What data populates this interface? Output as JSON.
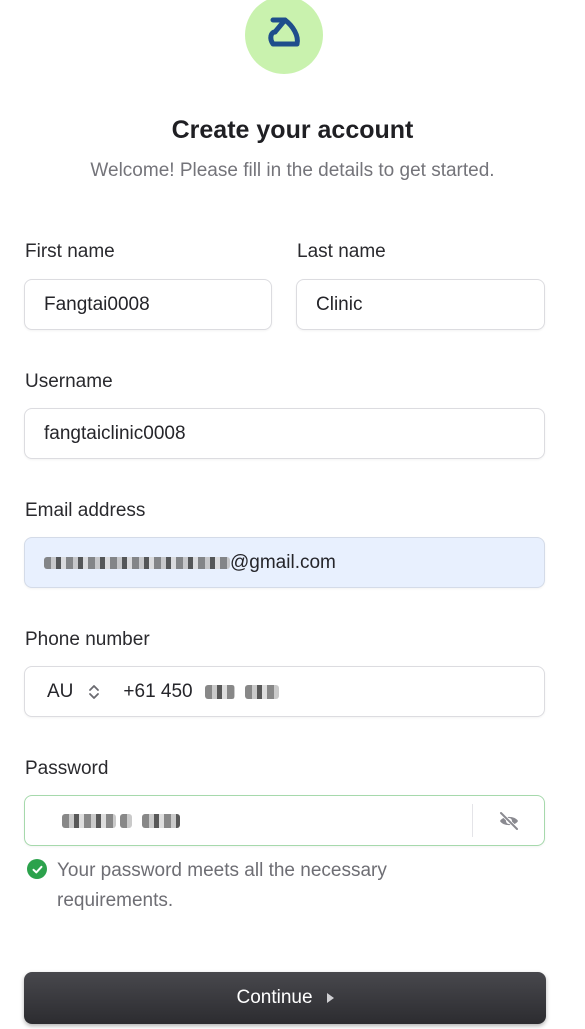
{
  "header": {
    "title": "Create your account",
    "subtitle": "Welcome! Please fill in the details to get started."
  },
  "form": {
    "first_name": {
      "label": "First name",
      "value": "Fangtai0008"
    },
    "last_name": {
      "label": "Last name",
      "value": "Clinic"
    },
    "username": {
      "label": "Username",
      "value": "fangtaiclinic0008"
    },
    "email": {
      "label": "Email address",
      "value_suffix": "@gmail.com"
    },
    "phone": {
      "label": "Phone number",
      "country": "AU",
      "prefix": "+61 450"
    },
    "password": {
      "label": "Password"
    },
    "password_validation": "Your password meets all the necessary requirements."
  },
  "actions": {
    "continue_label": "Continue"
  },
  "colors": {
    "logo_bg": "#c9f2ae",
    "logo_mark": "#1e4e8c",
    "autofill_bg": "#e8f0fe",
    "valid_border": "#a6d9ac",
    "success_green": "#2ca24c",
    "button_bg": "#3a3a3e"
  },
  "icons": [
    "logo-mark-icon",
    "chevron-up-down-icon",
    "eye-slash-icon",
    "check-circle-icon",
    "play-icon"
  ]
}
